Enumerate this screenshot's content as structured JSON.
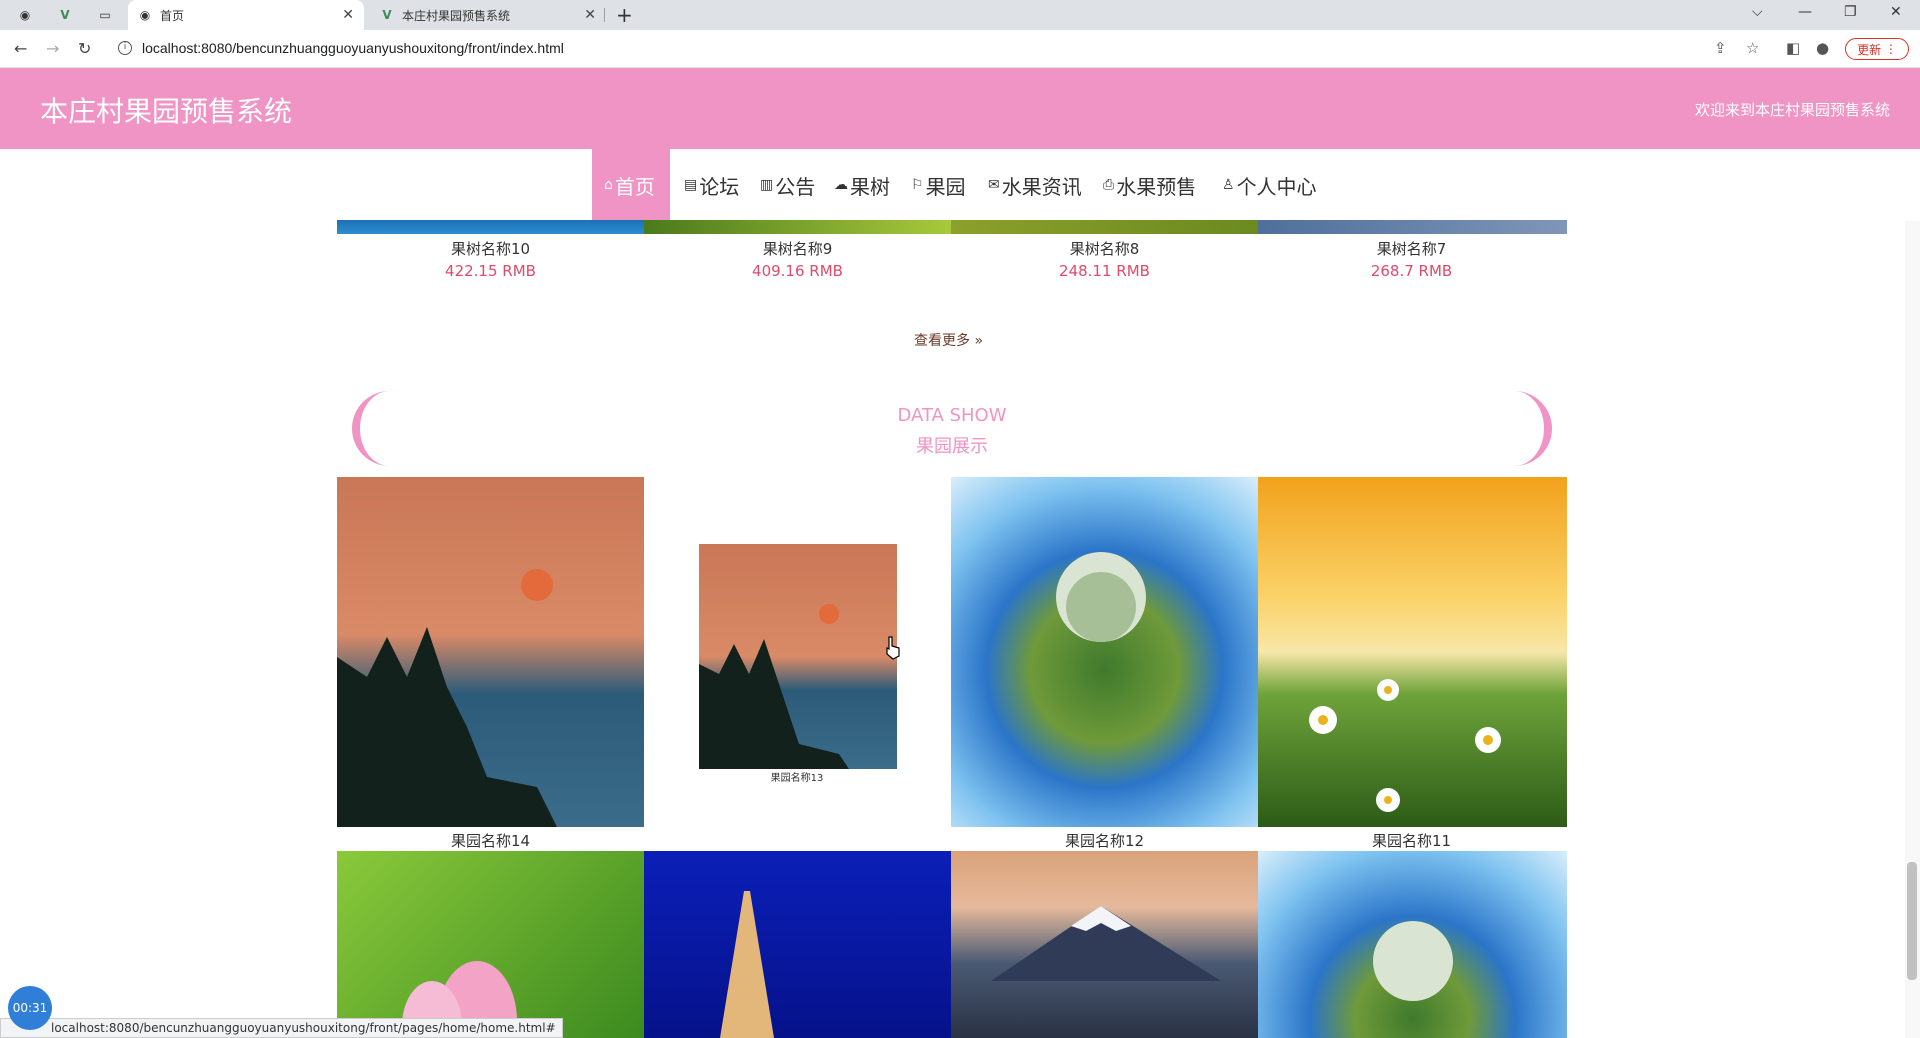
{
  "browser": {
    "tabs": [
      {
        "label": "首页",
        "active": true
      },
      {
        "label": "本庄村果园预售系统",
        "active": false
      }
    ],
    "url": "localhost:8080/bencunzhuangguoyuanyushouxitong/front/index.html",
    "update_label": "更新",
    "status_url": "localhost:8080/bencunzhuangguoyuanyushouxitong/front/pages/home/home.html#"
  },
  "header": {
    "title": "本庄村果园预售系统",
    "welcome": "欢迎来到本庄村果园预售系统"
  },
  "nav": [
    {
      "label": "首页",
      "icon": "home-icon",
      "active": true
    },
    {
      "label": "论坛",
      "icon": "forum-icon"
    },
    {
      "label": "公告",
      "icon": "notice-icon"
    },
    {
      "label": "果树",
      "icon": "tree-icon"
    },
    {
      "label": "果园",
      "icon": "flag-icon"
    },
    {
      "label": "水果资讯",
      "icon": "mail-icon"
    },
    {
      "label": "水果预售",
      "icon": "printer-icon"
    },
    {
      "label": "个人中心",
      "icon": "user-icon"
    }
  ],
  "products": [
    {
      "name": "果树名称10",
      "price": "422.15 RMB"
    },
    {
      "name": "果树名称9",
      "price": "409.16 RMB"
    },
    {
      "name": "果树名称8",
      "price": "248.11 RMB"
    },
    {
      "name": "果树名称7",
      "price": "268.7 RMB"
    }
  ],
  "more_label": "查看更多",
  "show": {
    "title_en": "DATA SHOW",
    "title_cn": "果园展示"
  },
  "orchards": [
    {
      "name": "果园名称14"
    },
    {
      "name": "果园名称13"
    },
    {
      "name": "果园名称12"
    },
    {
      "name": "果园名称11"
    }
  ],
  "timer": "00:31"
}
